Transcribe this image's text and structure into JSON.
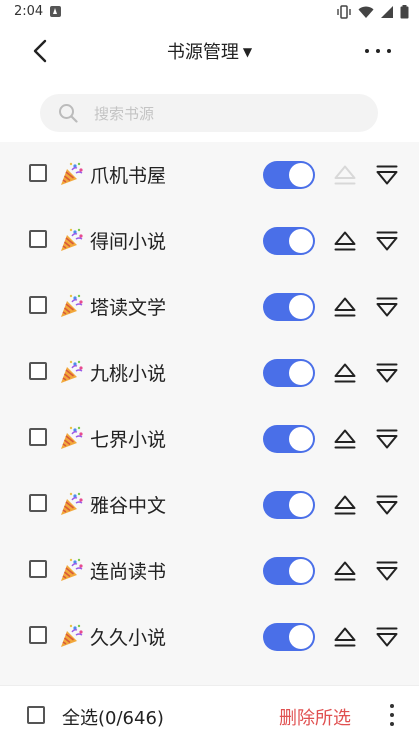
{
  "status_bar": {
    "time": "2:04"
  },
  "app_bar": {
    "title": "书源管理",
    "title_caret": "▼"
  },
  "search": {
    "placeholder": "搜索书源",
    "value": ""
  },
  "sources": [
    {
      "name": "爪机书屋",
      "enabled": true,
      "can_move_up": false
    },
    {
      "name": "得间小说",
      "enabled": true,
      "can_move_up": true
    },
    {
      "name": "塔读文学",
      "enabled": true,
      "can_move_up": true
    },
    {
      "name": "九桃小说",
      "enabled": true,
      "can_move_up": true
    },
    {
      "name": "七界小说",
      "enabled": true,
      "can_move_up": true
    },
    {
      "name": "雅谷中文",
      "enabled": true,
      "can_move_up": true
    },
    {
      "name": "连尚读书",
      "enabled": true,
      "can_move_up": true
    },
    {
      "name": "久久小说",
      "enabled": true,
      "can_move_up": true
    }
  ],
  "footer": {
    "select_all_label": "全选(0/646)",
    "delete_label": "删除所选"
  },
  "colors": {
    "accent": "#4a6fe8",
    "danger": "#e05050",
    "list_bg": "#f7f7f7"
  },
  "icons": {
    "back": "arrow-left-icon",
    "more": "more-horizontal-icon",
    "search": "search-icon",
    "source": "party-popper-icon",
    "up": "move-up-icon",
    "down": "move-down-icon"
  }
}
